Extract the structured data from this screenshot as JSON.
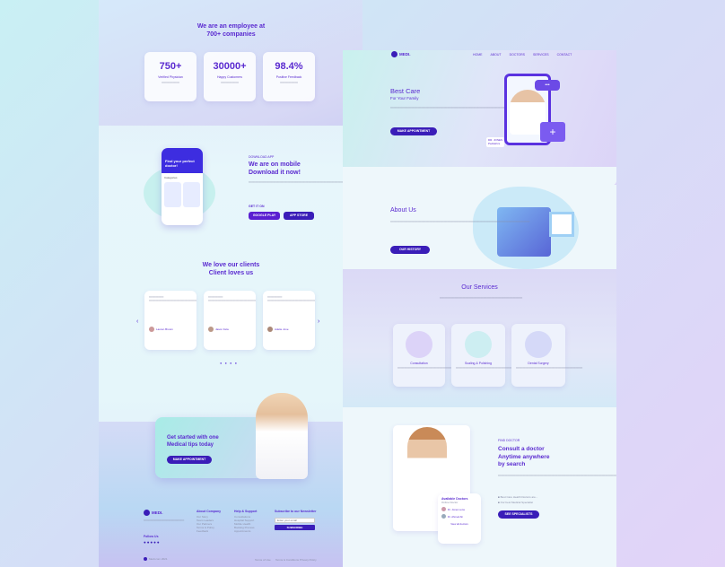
{
  "left": {
    "employee_title": "We are an employee at\n700+ companies",
    "stats": [
      {
        "value": "750+",
        "label": "Verified Physician"
      },
      {
        "value": "30000+",
        "label": "Happy Customers"
      },
      {
        "value": "98.4%",
        "label": "Positive Feedback"
      }
    ],
    "app": {
      "kicker": "DOWNLOAD APP",
      "title": "We are on mobile\nDownload it now!",
      "get_it": "GET IT ON",
      "google": "GOOGLE PLAY",
      "apple": "APP STORE",
      "phone_title": "Find your perfect doctor!",
      "phone_sub": "Categories"
    },
    "testimonials": {
      "title": "We love our clients\nClient loves us",
      "cards": [
        {
          "name": "Lauren Brown"
        },
        {
          "name": "Jason Fela"
        },
        {
          "name": "Adelie Jove"
        }
      ]
    },
    "cta": {
      "title": "Get started with one\nMedical tips today",
      "button": "MAKE APPOINTMENT"
    },
    "footer": {
      "logo": "MEDI.",
      "cols": [
        {
          "title": "About Company",
          "items": [
            "Our Story",
            "Team Leaders",
            "Our Partners",
            "Terms & Policy",
            "Feedback"
          ]
        },
        {
          "title": "Help & Support",
          "items": [
            "Consultations",
            "Hospital Support",
            "Mobile Health",
            "Booking Process",
            "Appointments"
          ]
        },
        {
          "title": "Subscribe to our Newsletter"
        }
      ],
      "subscribe_placeholder": "Enter your email",
      "subscribe_button": "SUBSCRIBE",
      "follow": "Follow Us",
      "copyright": "Medi.com 2021",
      "links": [
        "Terms of Use",
        "Terms & Conditions",
        "Privacy Policy"
      ]
    }
  },
  "right": {
    "logo": "MEDI.",
    "nav": [
      "HOME",
      "ABOUT",
      "DOCTORS",
      "SERVICES",
      "CONTACT"
    ],
    "hero": {
      "title": "Best Care",
      "subtitle": "For Your Family",
      "button": "MAKE APPOINTMENT",
      "doctor_tag": "DR. JONES\nPediatrics"
    },
    "about": {
      "title": "About Us",
      "button": "OUR HISTORY"
    },
    "services": {
      "title": "Our Services",
      "items": [
        {
          "name": "Consultation"
        },
        {
          "name": "Scaling & Polishing"
        },
        {
          "name": "Dental Surgery"
        }
      ]
    },
    "find": {
      "kicker": "FIND DOCTOR",
      "title": "Consult a doctor\nAnytime anywhere\nby search",
      "bullets": [
        "Best Care Health Doctors are...",
        "Our best Medical Specialist"
      ],
      "button": "SEE SPECIALISTS",
      "avail_title": "Available Doctors",
      "avail_sub": "Online Doctor",
      "doctors": [
        "Dr. Jones Lena",
        "Dr. Ahmed Ali"
      ],
      "view_all": "View all doctors"
    }
  },
  "colors": {
    "primary": "#3a1db8",
    "accent": "#5a2ad0"
  }
}
